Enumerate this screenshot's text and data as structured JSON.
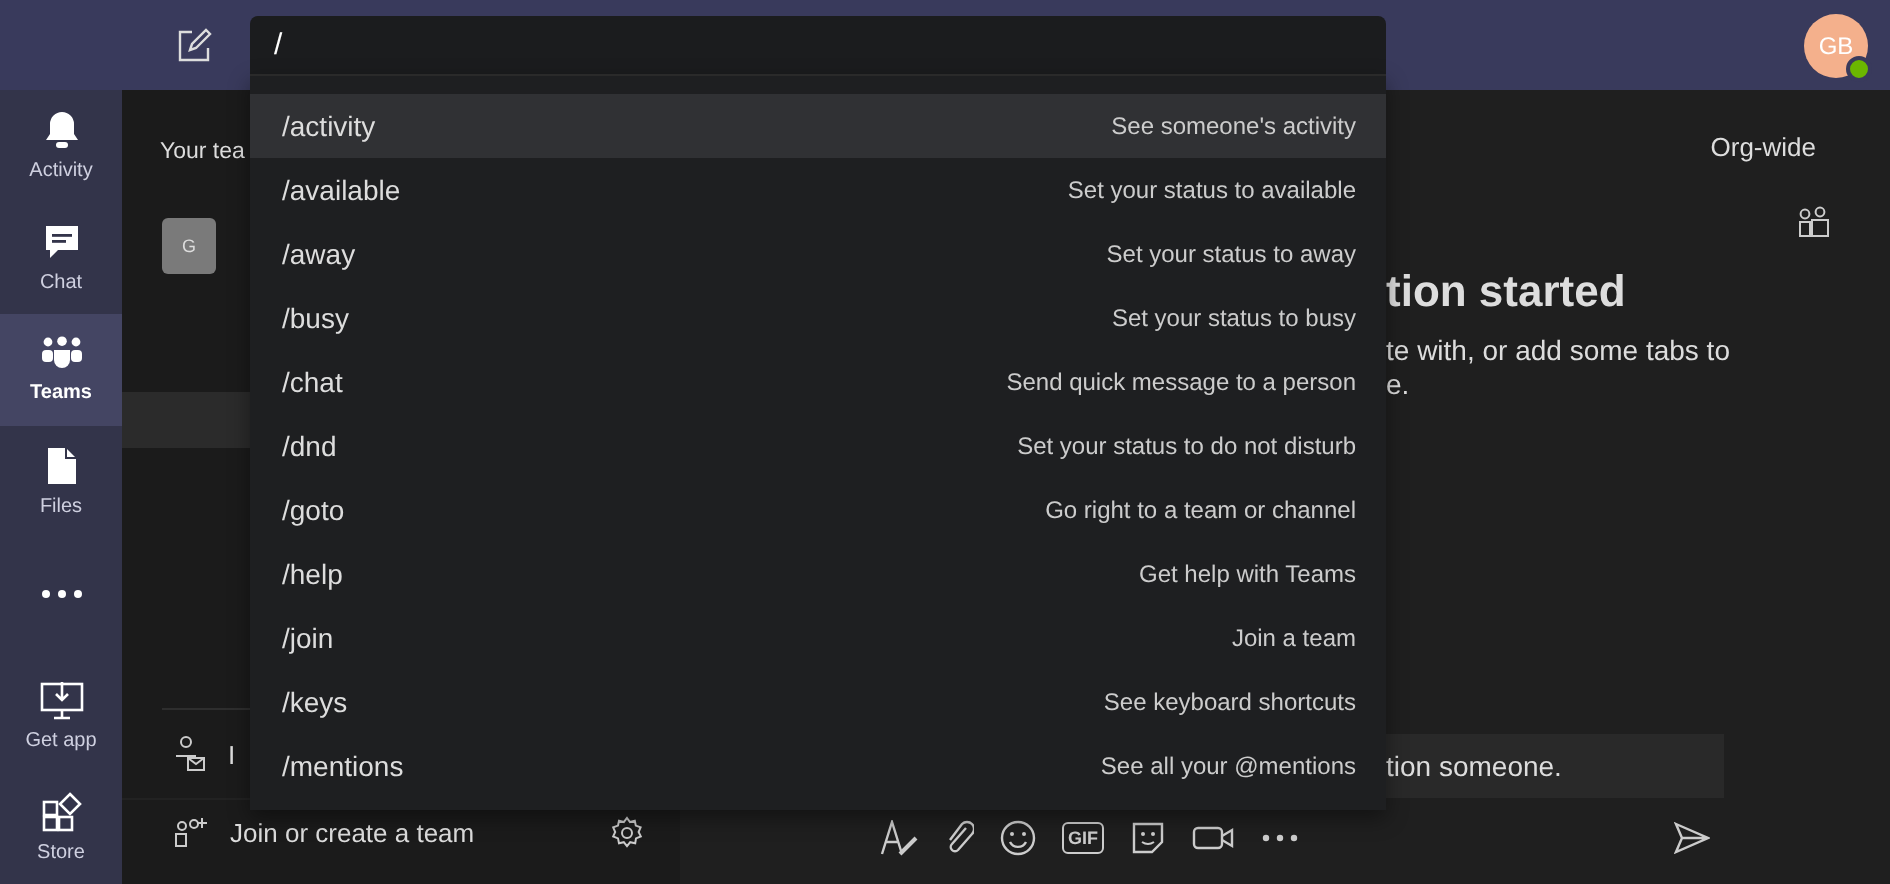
{
  "search": {
    "value": "/"
  },
  "user": {
    "initials": "GB",
    "online": true
  },
  "rail": [
    {
      "kind": "bell",
      "label": "Activity",
      "selected": false
    },
    {
      "kind": "chat",
      "label": "Chat",
      "selected": false
    },
    {
      "kind": "teams",
      "label": "Teams",
      "selected": true
    },
    {
      "kind": "files",
      "label": "Files",
      "selected": false
    },
    {
      "kind": "more",
      "selected": false
    },
    {
      "kind": "download",
      "label": "Get app",
      "selected": false
    },
    {
      "kind": "store",
      "label": "Store",
      "selected": false
    }
  ],
  "teams_panel": {
    "heading": "Your tea",
    "team_avatar": "G",
    "channels": [
      {
        "selected": true
      }
    ],
    "invite": "I",
    "join": "Join or create a team"
  },
  "main": {
    "scope": "Org-wide",
    "heading": "tion started",
    "body": [
      "te with, or add some tabs to",
      "e."
    ],
    "compose_hint": "tion someone."
  },
  "toolbar": [
    {
      "kind": "format"
    },
    {
      "kind": "attach"
    },
    {
      "kind": "emoji"
    },
    {
      "kind": "gif",
      "label": "GIF"
    },
    {
      "kind": "sticker"
    },
    {
      "kind": "meet"
    },
    {
      "kind": "more"
    }
  ],
  "commands": [
    {
      "command": "/activity",
      "description": "See someone's activity",
      "selected": true
    },
    {
      "command": "/available",
      "description": "Set your status to available",
      "selected": false
    },
    {
      "command": "/away",
      "description": "Set your status to away",
      "selected": false
    },
    {
      "command": "/busy",
      "description": "Set your status to busy",
      "selected": false
    },
    {
      "command": "/chat",
      "description": "Send quick message to a person",
      "selected": false
    },
    {
      "command": "/dnd",
      "description": "Set your status to do not disturb",
      "selected": false
    },
    {
      "command": "/goto",
      "description": "Go right to a team or channel",
      "selected": false
    },
    {
      "command": "/help",
      "description": "Get help with Teams",
      "selected": false
    },
    {
      "command": "/join",
      "description": "Join a team",
      "selected": false
    },
    {
      "command": "/keys",
      "description": "See keyboard shortcuts",
      "selected": false
    },
    {
      "command": "/mentions",
      "description": "See all your @mentions",
      "selected": false
    }
  ]
}
